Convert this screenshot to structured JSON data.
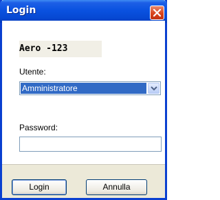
{
  "window": {
    "title": "Login",
    "close_icon": "close-icon",
    "app_name": "Aero -123"
  },
  "form": {
    "user_label": "Utente:",
    "user_value": "Amministratore",
    "password_label": "Password:",
    "password_value": ""
  },
  "buttons": {
    "login_label": "Login",
    "cancel_label": "Annulla"
  },
  "colors": {
    "titlebar": "#0a52e0",
    "close": "#d9441c",
    "selection": "#316ac5",
    "dialog_bg": "#ece9d8"
  }
}
